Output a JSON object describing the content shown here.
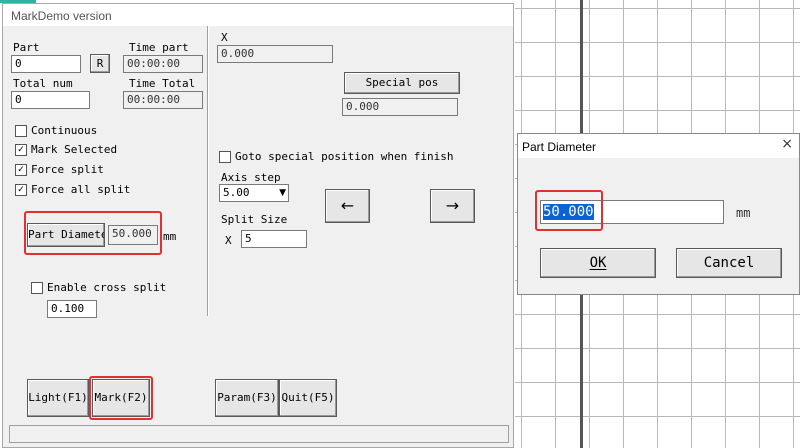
{
  "window": {
    "title": "MarkDemo version"
  },
  "part": {
    "label": "Part",
    "value": "0",
    "reset_button": "R"
  },
  "time_part": {
    "label": "Time part",
    "value": "00:00:00"
  },
  "total_num": {
    "label": "Total num",
    "value": "0"
  },
  "time_total": {
    "label": "Time Total",
    "value": "00:00:00"
  },
  "checkboxes": [
    {
      "label": "Continuous",
      "checked": false,
      "mark": ""
    },
    {
      "label": "Mark Selected",
      "checked": true,
      "mark": "✓"
    },
    {
      "label": "Force split",
      "checked": true,
      "mark": "✓"
    },
    {
      "label": "Force all split",
      "checked": true,
      "mark": "✓"
    }
  ],
  "part_diameter": {
    "button": "Part Diameter",
    "value": "50.000",
    "unit": "mm"
  },
  "cross_split": {
    "label": "Enable cross split",
    "checked": false,
    "value": "0.100"
  },
  "x_position": {
    "label": "X",
    "value": "0.000"
  },
  "special_pos": {
    "button": "Special pos",
    "value": "0.000"
  },
  "goto_special": {
    "label": "Goto special position when finish",
    "checked": false
  },
  "axis_step": {
    "label": "Axis step",
    "value": "5.00"
  },
  "split_size": {
    "label": "Split Size",
    "axis": "X",
    "value": "5"
  },
  "arrows": {
    "left": "←",
    "right": "→"
  },
  "bottom_buttons": {
    "light": "Light(F1)",
    "mark": "Mark(F2)",
    "param": "Param(F3)",
    "quit": "Quit(F5)"
  },
  "dialog": {
    "title": "Part Diameter",
    "close": "×",
    "value": "50.000",
    "unit": "mm",
    "ok": "OK",
    "cancel": "Cancel"
  },
  "colors": {
    "highlight": "#e03030",
    "selection": "#0a64d8",
    "accent": "#2bb5a2"
  }
}
